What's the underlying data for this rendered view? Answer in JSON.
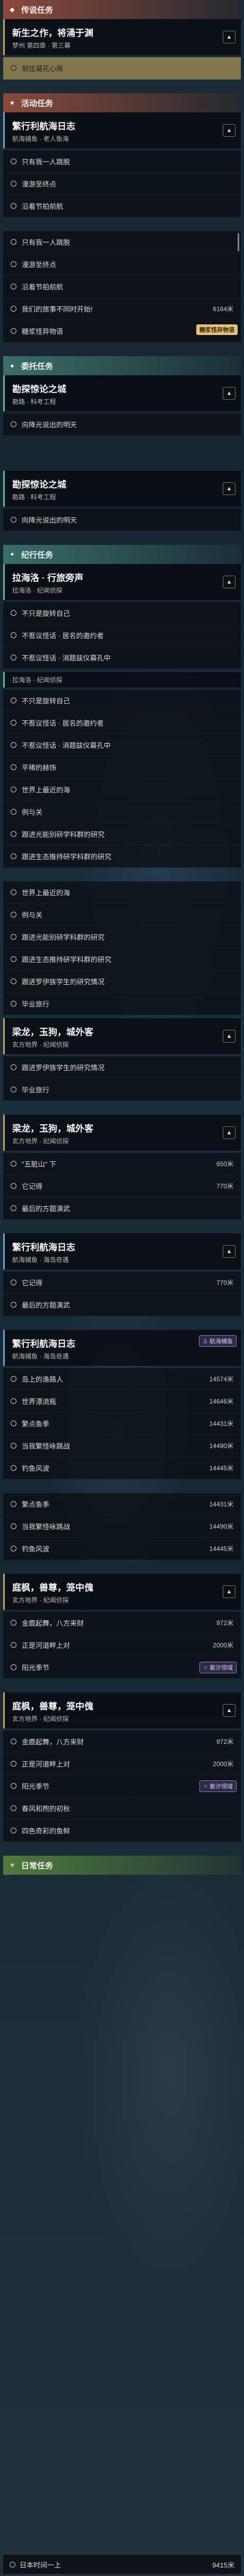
{
  "colors": {
    "accent_gold": "#c9a35a",
    "tag_purple": "#8a7ad0",
    "highlight": "#e6c878"
  },
  "sections": {
    "legend": {
      "header": "传说任务"
    },
    "event": {
      "header": "活动任务"
    },
    "side": {
      "header": "委托任务"
    },
    "world": {
      "header": "纪行任务"
    },
    "daily": {
      "header": "日常任务"
    }
  },
  "legend_quest": {
    "title": "新生之作，将涌于渊",
    "sub": "梦州 第四章 · 第三幕"
  },
  "legend_hint": "前往凝花心阁",
  "q1": {
    "title": "繁行利航海日志",
    "sub": "航海捕鱼 · 老人鱼海",
    "items": [
      "只有我一人跳脱",
      "漫游至终点",
      "沿着节拍前航",
      "只有我一人跳脱",
      "漫游至终点",
      "沿着节拍前航",
      "我们的旅事不同时开始!",
      "糖浆怪异物语"
    ],
    "dist": "6164米",
    "tag": "糖浆怪异物语"
  },
  "q2": {
    "title": "勘探惊论之城",
    "sub": "勘路 · 科考工程",
    "items": [
      "向降光说出的明天"
    ]
  },
  "q3": {
    "title": "勘探惊论之城",
    "sub": "勘路 · 科考工程",
    "items": [
      "向降光说出的明天"
    ]
  },
  "q4": {
    "title": "拉海洛 · 行旅旁声",
    "sub": "拉海洛 · 纪闻侦探",
    "items": [
      "不只是旋转自己",
      "不惹议怪话 · 居名的邀约者",
      "不惹议怪话 · 消题兹仪幕孔中"
    ],
    "sub2": "拉海洛 · 纪闻侦探",
    "items2": [
      "不只是旋转自己",
      "不惹议怪话 · 居名的邀约者",
      "不惹议怪话 · 消题兹仪幕孔中",
      "平稀的赫饰",
      "世界上最近的海",
      "例与关",
      "跟进光能别研学科群的研究",
      "跟进生态推持研学科群的研究",
      "跟进罗伊族学生的研究情况",
      "毕业旅行"
    ]
  },
  "q5": {
    "title": "梁龙，玉狗，城外客",
    "sub": "玄方地界 · 纪闻侦探",
    "items": [
      "跟进罗伊族学生的研究情况",
      "毕业旅行"
    ]
  },
  "q6": {
    "title": "梁龙，玉狗，城外客",
    "sub": "玄方地界 · 纪闻侦探",
    "items": [
      "\"五脏山\" 下",
      "它记得",
      "最后的方题演武"
    ],
    "dists": [
      "650米",
      "770米"
    ]
  },
  "q7": {
    "title": "繁行利航海日志",
    "sub": "航海捕鱼 · 海岛奇遇",
    "items": [
      "它记得",
      "最后的方题演武"
    ],
    "dist": "770米"
  },
  "q8": {
    "title": "繁行利航海日志",
    "sub": "航海捕鱼 · 海岛奇遇",
    "tag": "航海捕鱼",
    "items": [
      "岛上的渔路人",
      "世界漂流瓶",
      "繁点鱼季",
      "当我繁怪咏跳战",
      "钓鱼风波",
      "繁点鱼季",
      "当我繁怪咏跳战",
      "钓鱼风波"
    ],
    "dists": [
      "14574米",
      "14646米",
      "14431米",
      "14490米",
      "14445米",
      "14431米",
      "14490米",
      "14445米"
    ]
  },
  "q9": {
    "title": "庭枫，兽尊，笼中傀",
    "sub": "玄方地界 · 纪闻侦探",
    "items": [
      "金鹿起舞，八方来财",
      "正是河道畔上对",
      "阳光季节"
    ],
    "dists": [
      "972米",
      "2000米"
    ],
    "tag": "紫汐领域"
  },
  "q10": {
    "title": "庭枫，兽尊，笼中傀",
    "sub": "玄方地界 · 纪闻侦探",
    "items": [
      "金鹿起舞，八方来财",
      "正是河道畔上对",
      "阳光季节",
      "春风和煦的初秋",
      "四色奇彩的鱼鲜"
    ],
    "dists": [
      "972米",
      "2000米"
    ],
    "tag": "紫汐领域"
  },
  "daily_item": {
    "label": "日本时间一上",
    "dist": "9415米"
  }
}
